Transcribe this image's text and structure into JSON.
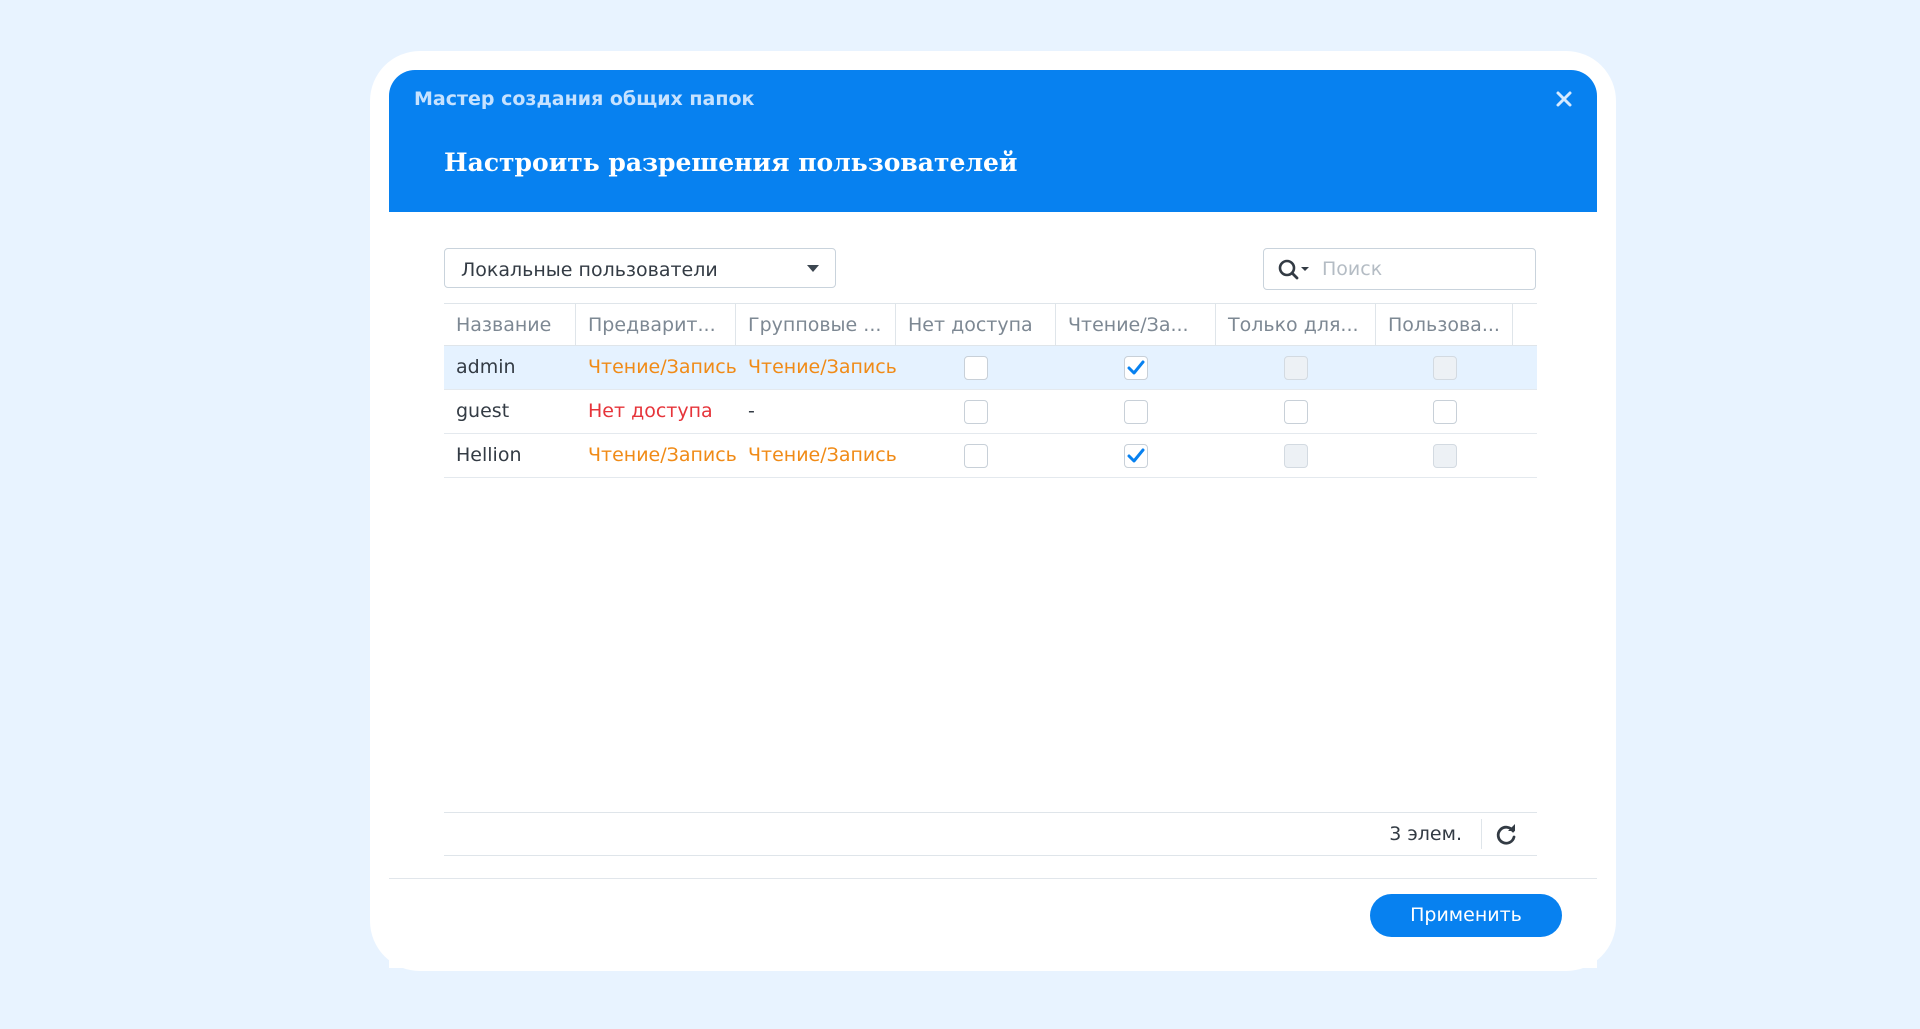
{
  "dialog": {
    "wizard_title": "Мастер создания общих папок",
    "step_title": "Настроить разрешения пользователей"
  },
  "toolbar": {
    "user_type": "Локальные пользователи",
    "search_placeholder": "Поиск"
  },
  "table": {
    "columns": [
      "Название",
      "Предварит...",
      "Групповые ...",
      "Нет доступа",
      "Чтение/За...",
      "Только для...",
      "Пользова..."
    ],
    "rows": [
      {
        "name": "admin",
        "preview": "Чтение/Запись",
        "group": "Чтение/Запись",
        "no_access": false,
        "read_write": true,
        "read_only": false,
        "custom": false,
        "selected": true,
        "other_disabled": true
      },
      {
        "name": "guest",
        "preview": "Нет доступа",
        "group": "-",
        "no_access": false,
        "read_write": false,
        "read_only": false,
        "custom": false,
        "selected": false,
        "other_disabled": false
      },
      {
        "name": "Hellion",
        "preview": "Чтение/Запись",
        "group": "Чтение/Запись",
        "no_access": false,
        "read_write": true,
        "read_only": false,
        "custom": false,
        "selected": false,
        "other_disabled": true
      }
    ]
  },
  "footer": {
    "count": "3 элем.",
    "apply_label": "Применить"
  },
  "colors": {
    "accent": "#0781f0",
    "orange": "#f08b17",
    "red": "#e6343a",
    "canvas": "#e8f3ff"
  }
}
